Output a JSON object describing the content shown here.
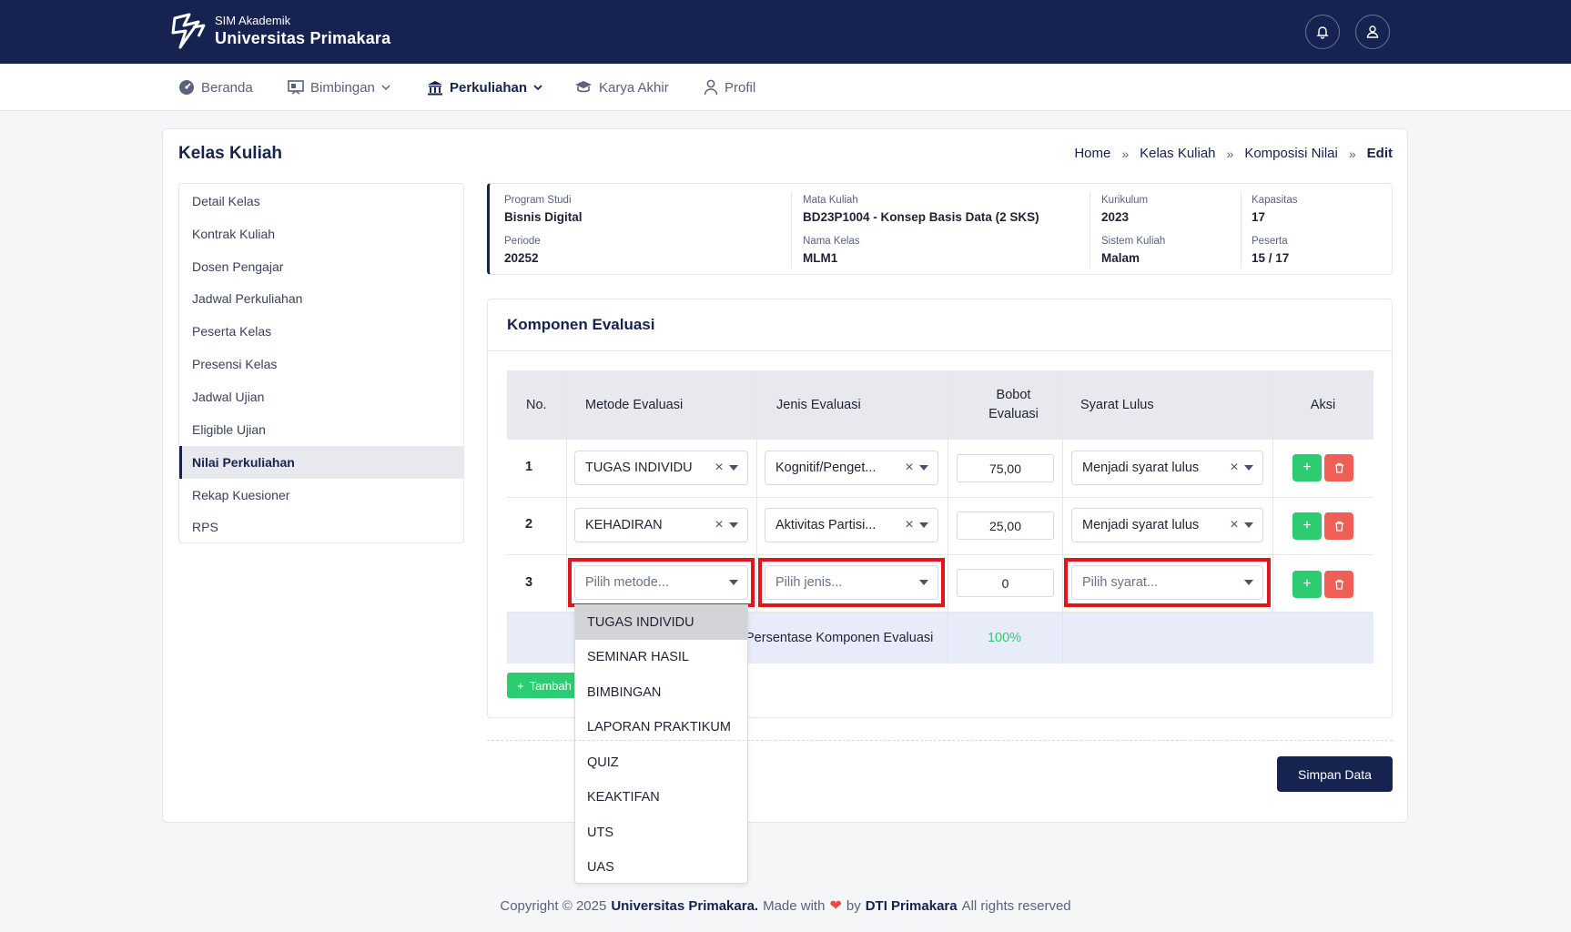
{
  "header": {
    "brand_sub": "SIM Akademik",
    "brand_title": "Universitas Primakara",
    "notification_icon": "bell-icon",
    "profile_icon": "user-icon"
  },
  "nav": [
    {
      "label": "Beranda",
      "icon": "dashboard-icon",
      "active": false
    },
    {
      "label": "Bimbingan",
      "icon": "board-icon",
      "active": false
    },
    {
      "label": "Perkuliahan",
      "icon": "building-icon",
      "active": true
    },
    {
      "label": "Karya Akhir",
      "icon": "graduation-cap-icon",
      "active": false
    },
    {
      "label": "Profil",
      "icon": "user-icon",
      "active": false
    }
  ],
  "page": {
    "title": "Kelas Kuliah",
    "breadcrumb": [
      "Home",
      "Kelas Kuliah",
      "Komposisi Nilai",
      "Edit"
    ],
    "breadcrumb_sep": "»"
  },
  "sidebar": {
    "items": [
      {
        "label": "Detail Kelas"
      },
      {
        "label": "Kontrak Kuliah"
      },
      {
        "label": "Dosen Pengajar"
      },
      {
        "label": "Jadwal Perkuliahan"
      },
      {
        "label": "Peserta Kelas"
      },
      {
        "label": "Presensi Kelas"
      },
      {
        "label": "Jadwal Ujian"
      },
      {
        "label": "Eligible Ujian"
      },
      {
        "label": "Nilai Perkuliahan",
        "active": true
      },
      {
        "label": "Rekap Kuesioner"
      },
      {
        "label": "RPS"
      }
    ]
  },
  "info": {
    "program_studi": {
      "label": "Program Studi",
      "value": "Bisnis Digital"
    },
    "periode": {
      "label": "Periode",
      "value": "20252"
    },
    "mata_kuliah": {
      "label": "Mata Kuliah",
      "value": "BD23P1004 - Konsep Basis Data (2 SKS)"
    },
    "nama_kelas": {
      "label": "Nama Kelas",
      "value": "MLM1"
    },
    "kurikulum": {
      "label": "Kurikulum",
      "value": "2023"
    },
    "sistem_kuliah": {
      "label": "Sistem Kuliah",
      "value": "Malam"
    },
    "kapasitas": {
      "label": "Kapasitas",
      "value": "17"
    },
    "peserta": {
      "label": "Peserta",
      "value": "15 / 17"
    }
  },
  "evaluasi": {
    "title": "Komponen Evaluasi",
    "columns": [
      "No.",
      "Metode Evaluasi",
      "Jenis Evaluasi",
      "Bobot Evaluasi",
      "Syarat Lulus",
      "Aksi"
    ],
    "rows": [
      {
        "no": "1",
        "metode": "TUGAS INDIVIDU",
        "jenis": "Kognitif/Penget...",
        "bobot": "75,00",
        "syarat": "Menjadi syarat lulus"
      },
      {
        "no": "2",
        "metode": "KEHADIRAN",
        "jenis": "Aktivitas Partisi...",
        "bobot": "25,00",
        "syarat": "Menjadi syarat lulus"
      },
      {
        "no": "3",
        "metode_placeholder": "Pilih metode...",
        "jenis_placeholder": "Pilih jenis...",
        "bobot": "0",
        "syarat_placeholder": "Pilih syarat..."
      }
    ],
    "clear_glyph": "×",
    "add_glyph": "+",
    "total_label": "Persentase Komponen Evaluasi",
    "total_value": "100%",
    "tambah_label": "Tambah"
  },
  "dropdown": {
    "options": [
      "TUGAS INDIVIDU",
      "SEMINAR HASIL",
      "BIMBINGAN",
      "LAPORAN PRAKTIKUM",
      "QUIZ",
      "KEAKTIFAN",
      "UTS",
      "UAS"
    ],
    "highlighted": "TUGAS INDIVIDU"
  },
  "actions": {
    "save_label": "Simpan Data"
  },
  "footer": {
    "prefix": "Copyright © 2025",
    "org": "Universitas Primakara.",
    "made_with": "Made with",
    "by": "by",
    "team": "DTI Primakara",
    "rights": "All rights reserved"
  },
  "colors": {
    "primary": "#16224f",
    "success": "#2ecc71",
    "danger": "#f05f55",
    "highlight": "#e0161c"
  }
}
